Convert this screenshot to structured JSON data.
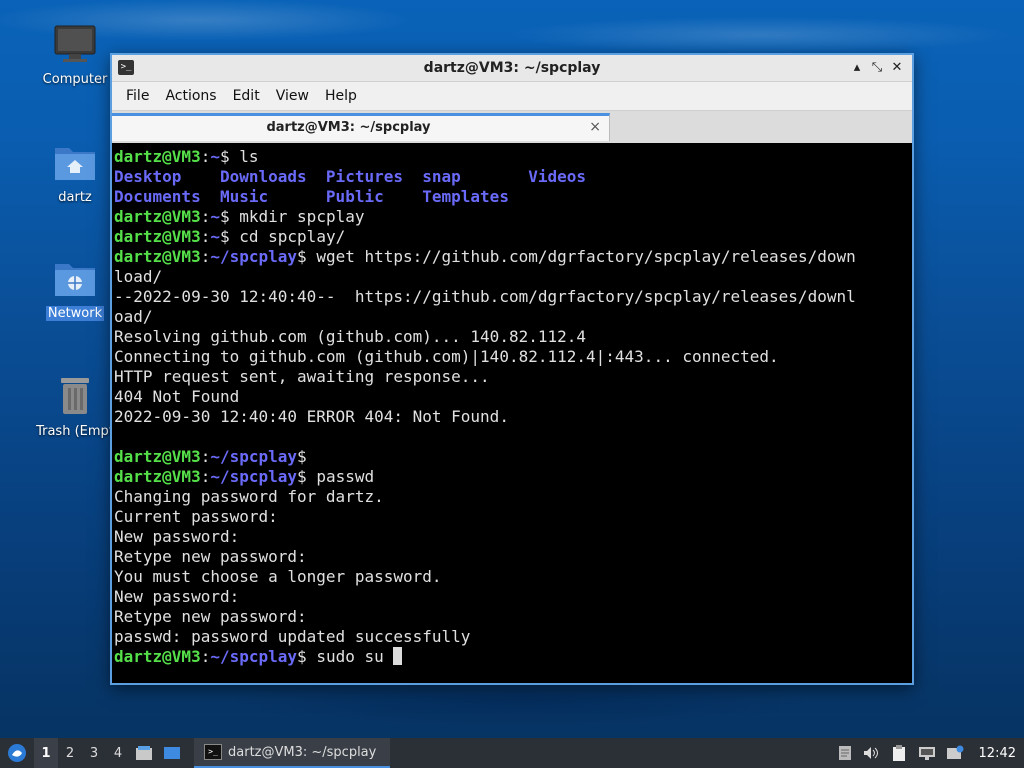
{
  "desktop": {
    "icons": [
      {
        "label": "Computer"
      },
      {
        "label": "dartz"
      },
      {
        "label": "Network"
      },
      {
        "label": "Trash (Empt"
      }
    ]
  },
  "window": {
    "title": "dartz@VM3: ~/spcplay",
    "menu": [
      "File",
      "Actions",
      "Edit",
      "View",
      "Help"
    ],
    "tab_title": "dartz@VM3: ~/spcplay",
    "tab_close": "×",
    "controls": {
      "minimize": "▴",
      "maximize": "⤡",
      "close": "✕"
    }
  },
  "terminal": {
    "lines": [
      [
        {
          "t": "dartz@VM3",
          "c": "g"
        },
        {
          "t": ":",
          "c": "w"
        },
        {
          "t": "~",
          "c": "b"
        },
        {
          "t": "$ ls",
          "c": "w"
        }
      ],
      [
        {
          "t": "Desktop    Downloads  Pictures  snap       Videos",
          "c": "b"
        }
      ],
      [
        {
          "t": "Documents  Music      Public    Templates",
          "c": "b"
        }
      ],
      [
        {
          "t": "dartz@VM3",
          "c": "g"
        },
        {
          "t": ":",
          "c": "w"
        },
        {
          "t": "~",
          "c": "b"
        },
        {
          "t": "$ mkdir spcplay",
          "c": "w"
        }
      ],
      [
        {
          "t": "dartz@VM3",
          "c": "g"
        },
        {
          "t": ":",
          "c": "w"
        },
        {
          "t": "~",
          "c": "b"
        },
        {
          "t": "$ cd spcplay/",
          "c": "w"
        }
      ],
      [
        {
          "t": "dartz@VM3",
          "c": "g"
        },
        {
          "t": ":",
          "c": "w"
        },
        {
          "t": "~/spcplay",
          "c": "b"
        },
        {
          "t": "$ wget https://github.com/dgrfactory/spcplay/releases/down",
          "c": "w"
        }
      ],
      [
        {
          "t": "load/",
          "c": "w"
        }
      ],
      [
        {
          "t": "--2022-09-30 12:40:40--  https://github.com/dgrfactory/spcplay/releases/downl",
          "c": "w"
        }
      ],
      [
        {
          "t": "oad/",
          "c": "w"
        }
      ],
      [
        {
          "t": "Resolving github.com (github.com)... 140.82.112.4",
          "c": "w"
        }
      ],
      [
        {
          "t": "Connecting to github.com (github.com)|140.82.112.4|:443... connected.",
          "c": "w"
        }
      ],
      [
        {
          "t": "HTTP request sent, awaiting response...",
          "c": "w"
        }
      ],
      [
        {
          "t": "404 Not Found",
          "c": "w"
        }
      ],
      [
        {
          "t": "2022-09-30 12:40:40 ERROR 404: Not Found.",
          "c": "w"
        }
      ],
      [
        {
          "t": "",
          "c": "w"
        }
      ],
      [
        {
          "t": "dartz@VM3",
          "c": "g"
        },
        {
          "t": ":",
          "c": "w"
        },
        {
          "t": "~/spcplay",
          "c": "b"
        },
        {
          "t": "$",
          "c": "w"
        }
      ],
      [
        {
          "t": "dartz@VM3",
          "c": "g"
        },
        {
          "t": ":",
          "c": "w"
        },
        {
          "t": "~/spcplay",
          "c": "b"
        },
        {
          "t": "$ passwd",
          "c": "w"
        }
      ],
      [
        {
          "t": "Changing password for dartz.",
          "c": "w"
        }
      ],
      [
        {
          "t": "Current password:",
          "c": "w"
        }
      ],
      [
        {
          "t": "New password:",
          "c": "w"
        }
      ],
      [
        {
          "t": "Retype new password:",
          "c": "w"
        }
      ],
      [
        {
          "t": "You must choose a longer password.",
          "c": "w"
        }
      ],
      [
        {
          "t": "New password:",
          "c": "w"
        }
      ],
      [
        {
          "t": "Retype new password:",
          "c": "w"
        }
      ],
      [
        {
          "t": "passwd: password updated successfully",
          "c": "w"
        }
      ],
      [
        {
          "t": "dartz@VM3",
          "c": "g"
        },
        {
          "t": ":",
          "c": "w"
        },
        {
          "t": "~/spcplay",
          "c": "b"
        },
        {
          "t": "$ sudo su ",
          "c": "w"
        }
      ]
    ]
  },
  "taskbar": {
    "workspaces": [
      "1",
      "2",
      "3",
      "4"
    ],
    "active_workspace": "1",
    "task_label": "dartz@VM3: ~/spcplay",
    "clock": "12:42"
  }
}
